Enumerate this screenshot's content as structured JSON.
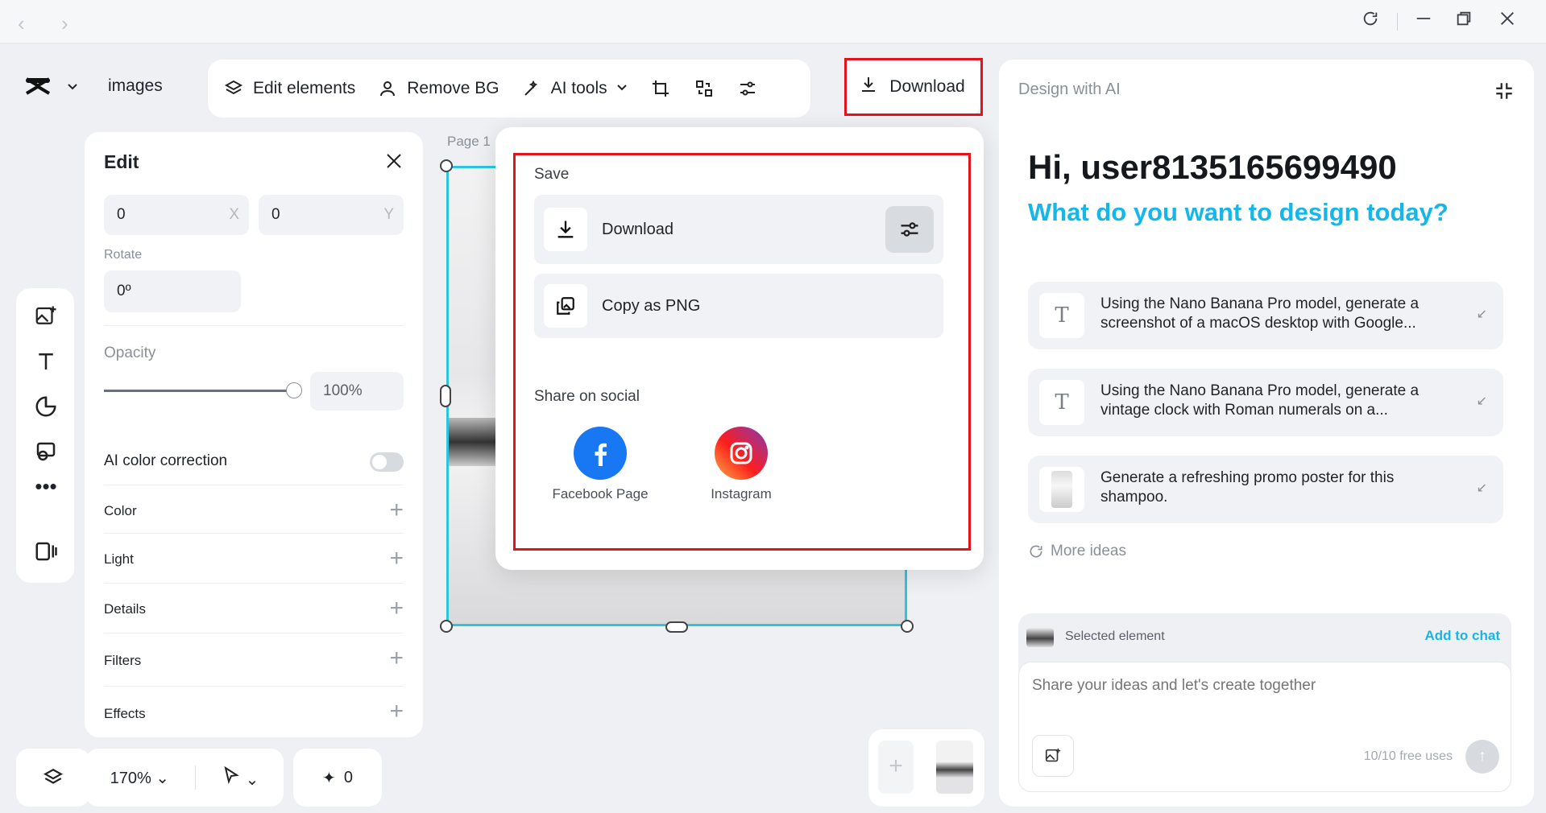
{
  "toolbar": {
    "project_name": "images",
    "edit_elements": "Edit elements",
    "remove_bg": "Remove BG",
    "ai_tools": "AI tools",
    "download": "Download"
  },
  "edit_panel": {
    "title": "Edit",
    "x_value": "0",
    "x_suffix": "X",
    "y_value": "0",
    "y_suffix": "Y",
    "rotate_label": "Rotate",
    "rotate_value": "0º",
    "opacity_label": "Opacity",
    "opacity_value": "100%",
    "opacity_fraction": 1.0,
    "ai_color_correction": "AI color correction",
    "ai_color_correction_on": false,
    "rows": [
      "Color",
      "Light",
      "Details",
      "Filters",
      "Effects"
    ]
  },
  "bottom": {
    "zoom": "170%",
    "sparkle_count": "0"
  },
  "canvas": {
    "page_label": "Page 1"
  },
  "download_popover": {
    "save_heading": "Save",
    "download_label": "Download",
    "copy_label": "Copy as PNG",
    "share_heading": "Share on social",
    "socials": [
      {
        "label": "Facebook Page",
        "icon": "facebook-icon",
        "color": "#1877f2"
      },
      {
        "label": "Instagram",
        "icon": "instagram-icon",
        "color": "#e1306c"
      }
    ]
  },
  "ai_panel": {
    "title": "Design with AI",
    "greeting": "Hi, user8135165699490",
    "subtitle": "What do you want to design today?",
    "suggestions": [
      {
        "icon": "text-icon",
        "text": "Using the Nano Banana Pro model, generate a screenshot of a macOS desktop with Google..."
      },
      {
        "icon": "text-icon",
        "text": "Using the Nano Banana Pro model, generate a vintage clock with Roman numerals on a..."
      },
      {
        "icon": "image-thumb",
        "text": "Generate a refreshing promo poster for this shampoo."
      }
    ],
    "more_ideas": "More ideas",
    "selected_element": "Selected element",
    "add_to_chat": "Add to chat",
    "input_placeholder": "Share your ideas and let's create together",
    "free_uses": "10/10 free uses"
  },
  "colors": {
    "accent": "#15b6e8",
    "highlight": "#e3131b",
    "selection": "#2ec4e0"
  }
}
